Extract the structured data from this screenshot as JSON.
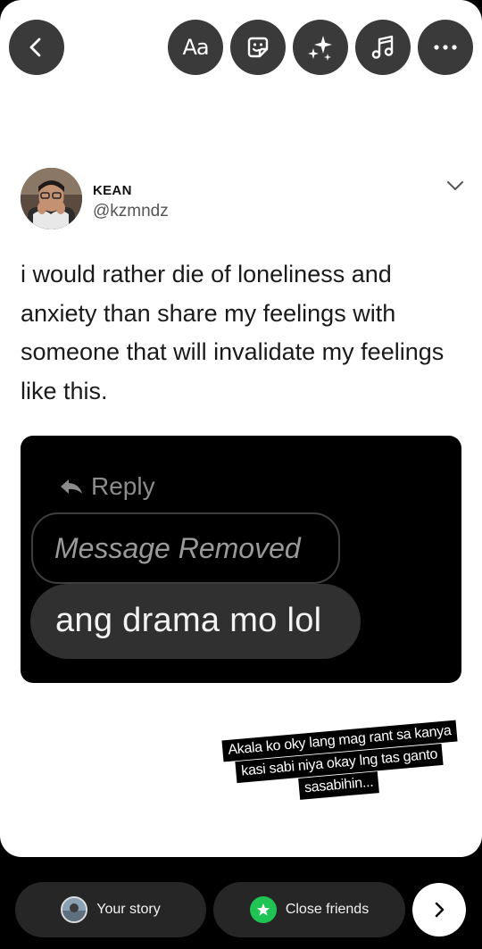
{
  "toolbar": {
    "back": "back-icon",
    "text_label": "Aa",
    "sticker": "sticker-icon",
    "effects": "sparkles-icon",
    "music": "music-note-icon",
    "more": "more-icon"
  },
  "tweet": {
    "name": "KEAN",
    "handle": "@kzmndz",
    "lines": [
      "i would rather die of loneliness and",
      "anxiety than share my feelings with",
      "someone that will invalidate my feelings",
      "like this."
    ]
  },
  "screenshot": {
    "reply_label": "Reply",
    "removed_label": "Message Removed",
    "message": "ang drama mo lol"
  },
  "caption": {
    "lines": [
      "Akala ko oky lang mag rant sa kanya",
      "kasi sabi niya okay lng tas ganto",
      "sasabihin..."
    ]
  },
  "share": {
    "your_story": "Your story",
    "close_friends": "Close friends"
  },
  "colors": {
    "close_friends_green": "#1fc455",
    "toolbar_button": "#3a3a3a",
    "pill_background": "#262626"
  }
}
